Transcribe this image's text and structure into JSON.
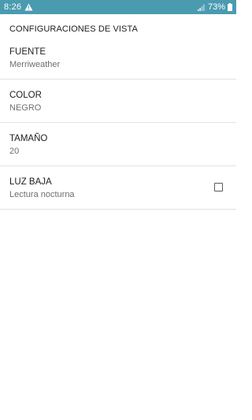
{
  "status_bar": {
    "time": "8:26",
    "battery_text": "73%",
    "icons": [
      "alert-icon",
      "signal-icon",
      "battery-icon"
    ],
    "background": "#4a9bb0"
  },
  "header": {
    "section_title": "CONFIGURACIONES DE VISTA"
  },
  "settings": {
    "items": [
      {
        "label": "FUENTE",
        "value": "Merriweather"
      },
      {
        "label": "COLOR",
        "value": "NEGRO"
      },
      {
        "label": "TAMAÑO",
        "value": "20"
      },
      {
        "label": "LUZ BAJA",
        "value": "Lectura nocturna",
        "checked": false
      }
    ]
  }
}
